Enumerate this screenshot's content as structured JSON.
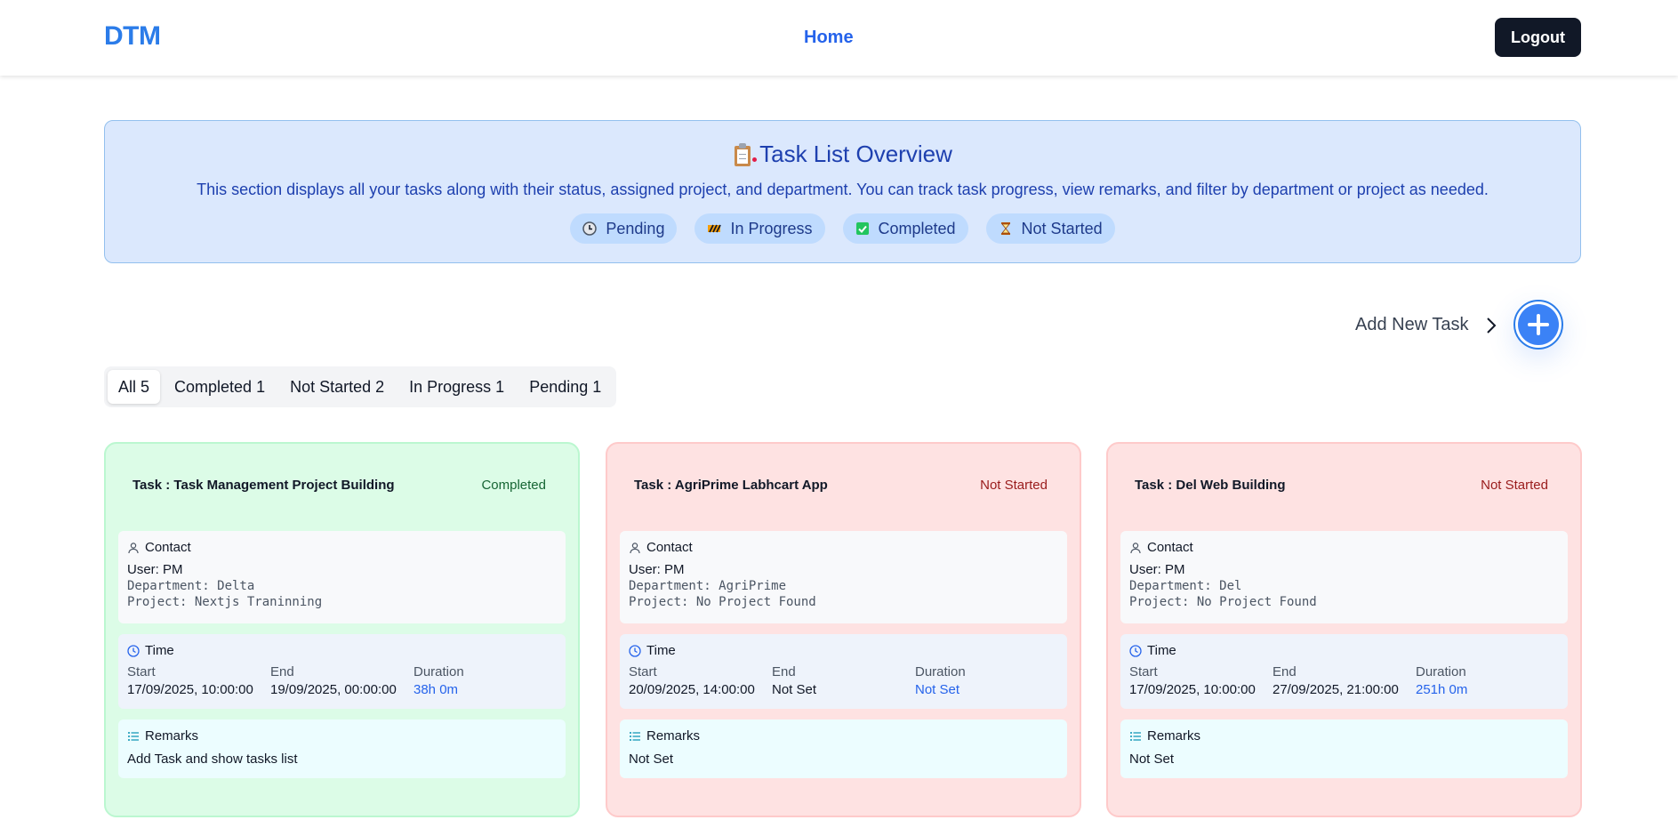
{
  "header": {
    "logo": "DTM",
    "nav_home": "Home",
    "logout": "Logout"
  },
  "overview": {
    "title": "Task List Overview",
    "description": "This section displays all your tasks along with their status, assigned project, and department. You can track task progress, view remarks, and filter by department or project as needed.",
    "legend": [
      {
        "label": "Pending",
        "icon": "clock-icon"
      },
      {
        "label": "In Progress",
        "icon": "construction-icon"
      },
      {
        "label": "Completed",
        "icon": "check-box-icon"
      },
      {
        "label": "Not Started",
        "icon": "hourglass-icon"
      }
    ]
  },
  "add_task": {
    "label": "Add New Task"
  },
  "filters": [
    {
      "label": "All 5",
      "active": true
    },
    {
      "label": "Completed 1",
      "active": false
    },
    {
      "label": "Not Started 2",
      "active": false
    },
    {
      "label": "In Progress 1",
      "active": false
    },
    {
      "label": "Pending 1",
      "active": false
    }
  ],
  "labels": {
    "task_prefix": "Task :",
    "contact": "Contact",
    "time": "Time",
    "remarks": "Remarks",
    "start": "Start",
    "end": "End",
    "duration": "Duration"
  },
  "tasks": [
    {
      "name": "Task Management Project Building",
      "status": "Completed",
      "user": "User: PM",
      "department": "Department: Delta",
      "project": "Project: Nextjs Traninning",
      "start": "17/09/2025, 10:00:00",
      "end": "19/09/2025, 00:00:00",
      "duration": "38h 0m",
      "remarks": "Add Task and show tasks list"
    },
    {
      "name": "AgriPrime Labhcart App",
      "status": "Not Started",
      "user": "User: PM",
      "department": "Department: AgriPrime",
      "project": "Project: No Project Found",
      "start": "20/09/2025, 14:00:00",
      "end": "Not Set",
      "duration": "Not Set",
      "remarks": "Not Set"
    },
    {
      "name": "Del Web Building",
      "status": "Not Started",
      "user": "User: PM",
      "department": "Department: Del",
      "project": "Project: No Project Found",
      "start": "17/09/2025, 10:00:00",
      "end": "27/09/2025, 21:00:00",
      "duration": "251h 0m",
      "remarks": "Not Set"
    }
  ],
  "colors": {
    "completed_bg": "#dcfce7",
    "completed_border": "#bbf7d0",
    "completed_text": "#166534",
    "not_started_bg": "#fee2e2",
    "not_started_border": "#fecaca",
    "not_started_text": "#991b1b",
    "accent": "#2563eb"
  }
}
